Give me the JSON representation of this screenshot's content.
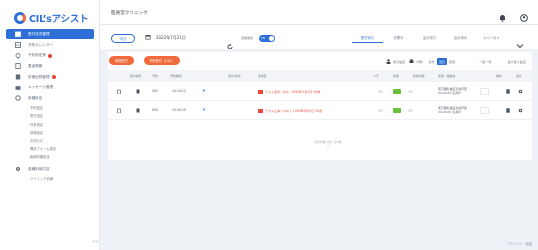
{
  "app": {
    "logo_text": "CIL’sアシスト",
    "brand_color": "#2d6fd6",
    "accent_color": "#f06a3c"
  },
  "sidebar": {
    "items": [
      {
        "label": "受付状況管理",
        "icon": "calendar-icon",
        "active": true
      },
      {
        "label": "予約カレンダー",
        "icon": "grid-icon"
      },
      {
        "label": "予約設定等",
        "icon": "pin-icon",
        "badge": true
      },
      {
        "label": "患者情報",
        "icon": "person-icon"
      },
      {
        "label": "診療記録管理",
        "icon": "document-icon",
        "badge": true
      },
      {
        "label": "メッセージ管理",
        "icon": "mail-icon"
      },
      {
        "label": "各種設定",
        "icon": "gear-icon"
      }
    ],
    "sub_items": [
      "予約設定",
      "受付設定",
      "外来設定",
      "診療設定",
      "お知らせ",
      "問診フォーム設定",
      "医師情報設定"
    ],
    "bottom_items": [
      {
        "label": "各種利用内容",
        "icon": "settings-icon"
      },
      {
        "label": "クリニック情報"
      }
    ],
    "collapse_label": "<<"
  },
  "header": {
    "clinic_name": "医貢堂クリニック",
    "icons": [
      "bell-icon",
      "user-icon"
    ]
  },
  "toolbar": {
    "today_button": "今日",
    "date_value": "2022年7月21日",
    "auto_update_label": "自動更新",
    "toggle_label": "ON",
    "status_tabs": [
      "受付待ち",
      "診察中",
      "会計待ち",
      "会計済み",
      "キャンセル"
    ],
    "active_tab_index": 0
  },
  "actions": {
    "btn_checkin": "新規受付",
    "btn_reserve": "予約受付（CSV）",
    "tools": [
      {
        "label": "表示設定",
        "icon": "person-icon"
      },
      {
        "label": "印刷",
        "icon": "printer-icon"
      }
    ],
    "segments": [
      "全件",
      "当日",
      "来院"
    ],
    "segment_active": 1,
    "right_link_1": "一括一覧",
    "right_link_2": "並び替え設定"
  },
  "table": {
    "headers": [
      "受付番号",
      "予約",
      "予約時間",
      "受付/呼出",
      "患者名",
      "メモ",
      "状態",
      "診療内容",
      "住所・連絡先",
      "操作",
      "会計"
    ],
    "rows": [
      {
        "no": "002",
        "time": "10:14:12",
        "mark": "P",
        "patient": "テスト田中（ﾀﾅｶ）1995年1月1日 26歳",
        "addr_1": "東京都杉並区高井戸東",
        "addr_2": "XX-XX-XX 高井戸"
      },
      {
        "no": "003",
        "time": "10:34:15",
        "mark": "P",
        "patient": "テスト山本（ﾔﾏﾓﾄ）1990年5月5日 32歳",
        "addr_1": "東京都杉並区高井戸東",
        "addr_2": "XX-XX-XX 高井戸"
      }
    ]
  },
  "pager": {
    "line1": "表示件数 2件 / 全2件",
    "line2": "1"
  },
  "footer": {
    "text": "プライバシー保護"
  }
}
